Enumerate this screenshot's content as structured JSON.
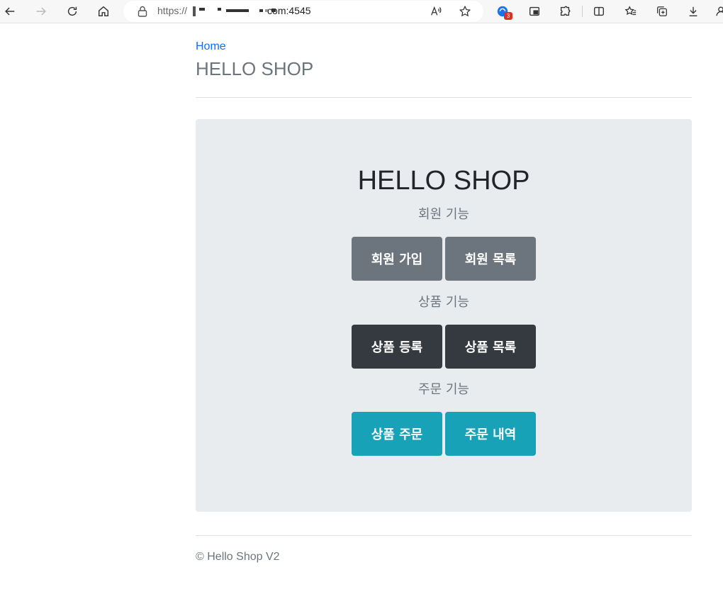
{
  "browser": {
    "url_scheme": "https://",
    "url_host_suffix": "com:4545",
    "notification_count": "3"
  },
  "page": {
    "breadcrumb": "Home",
    "site_title": "HELLO SHOP",
    "jumbotron_title": "HELLO SHOP",
    "sections": [
      {
        "label": "회원 기능",
        "buttons": [
          "회원 가입",
          "회원 목록"
        ]
      },
      {
        "label": "상품 기능",
        "buttons": [
          "상품 등록",
          "상품 목록"
        ]
      },
      {
        "label": "주문 기능",
        "buttons": [
          "상품 주문",
          "주문 내역"
        ]
      }
    ],
    "footer": "© Hello Shop V2"
  },
  "colors": {
    "link": "#0d6efd",
    "secondary": "#6c757d",
    "dark": "#343a40",
    "info": "#17a2b8",
    "jumbotron_bg": "#e9ecef"
  }
}
